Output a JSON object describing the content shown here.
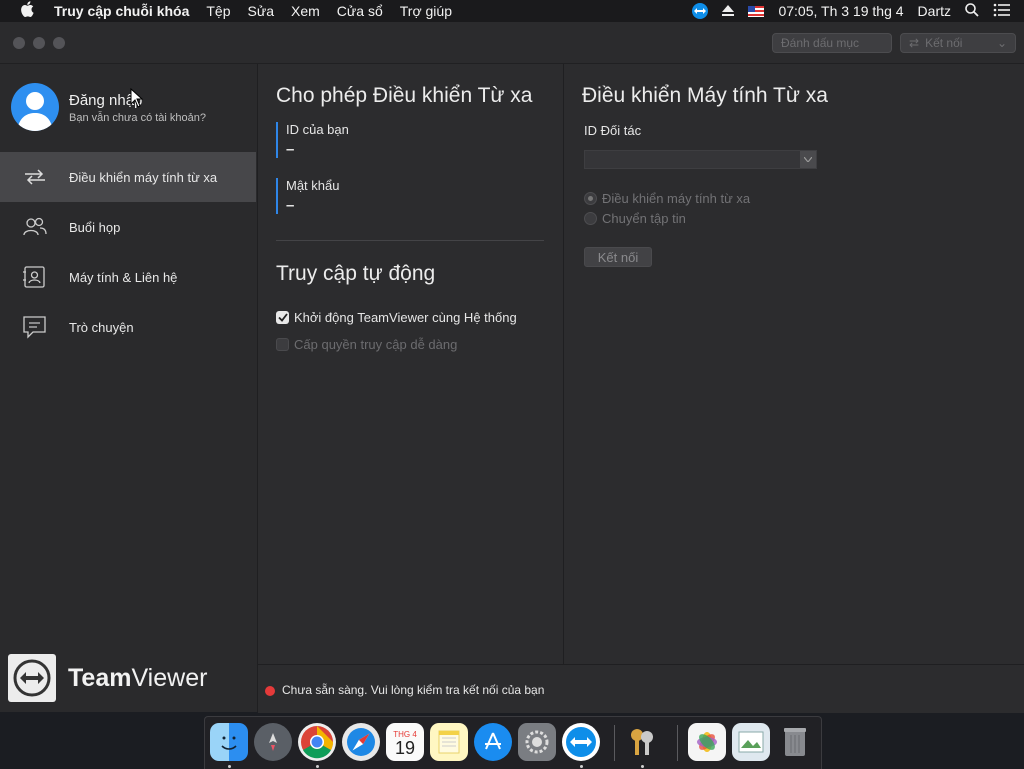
{
  "menubar": {
    "app_name": "Truy cập chuỗi khóa",
    "menus": [
      "Tệp",
      "Sửa",
      "Xem",
      "Cửa sổ",
      "Trợ giúp"
    ],
    "clock": "07:05, Th 3 19 thg 4",
    "user": "Dartz",
    "icons": [
      "apple-icon",
      "teamviewer-icon",
      "eject-icon",
      "flag-icon",
      "search-icon",
      "list-icon"
    ]
  },
  "window": {
    "title_buttons": [
      "Đánh dấu mục"
    ],
    "toolbar_connect": "Kết nối"
  },
  "sidebar": {
    "login_title": "Đăng nhập",
    "login_subtitle": "Bạn vẫn chưa có tài khoản?",
    "items": [
      {
        "label": "Điều khiển máy tính từ xa",
        "icon": "arrows-exchange-icon",
        "active": true
      },
      {
        "label": "Buổi họp",
        "icon": "people-icon",
        "active": false
      },
      {
        "label": "Máy tính & Liên hệ",
        "icon": "contact-card-icon",
        "active": false
      },
      {
        "label": "Trò chuyện",
        "icon": "chat-icon",
        "active": false
      }
    ],
    "brand_bold": "Team",
    "brand_regular": "Viewer"
  },
  "allow_remote": {
    "title": "Cho phép Điều khiển Từ xa",
    "id_label": "ID của bạn",
    "id_value": "–",
    "password_label": "Mật khẩu",
    "password_value": "–"
  },
  "unattended": {
    "title": "Truy cập tự động",
    "start_with_system": "Khởi động TeamViewer cùng Hệ thống",
    "start_with_system_checked": true,
    "easy_access": "Cấp quyền truy cập dễ dàng",
    "easy_access_checked": false
  },
  "control_remote": {
    "title": "Điều khiển Máy tính Từ xa",
    "partner_id_label": "ID Đối tác",
    "partner_id_value": "",
    "radio_remote": "Điều khiển máy tính từ xa",
    "radio_file": "Chuyển tập tin",
    "connect_button": "Kết nối"
  },
  "status": {
    "text": "Chưa sẵn sàng. Vui lòng kiểm tra kết nối của bạn",
    "color": "#e53a3a"
  },
  "dock": {
    "calendar_month": "THG 4",
    "calendar_day": "19",
    "apps": [
      "finder-icon",
      "launchpad-icon",
      "chrome-icon",
      "safari-icon",
      "calendar-icon",
      "notes-icon",
      "app-store-icon",
      "system-preferences-icon",
      "teamviewer-icon",
      "keychain-icon",
      "photos-icon",
      "preview-icon",
      "trash-icon"
    ]
  },
  "colors": {
    "accent": "#2f86e8",
    "sidebar_active": "#47474a",
    "window_bg": "#2c2c2e"
  }
}
